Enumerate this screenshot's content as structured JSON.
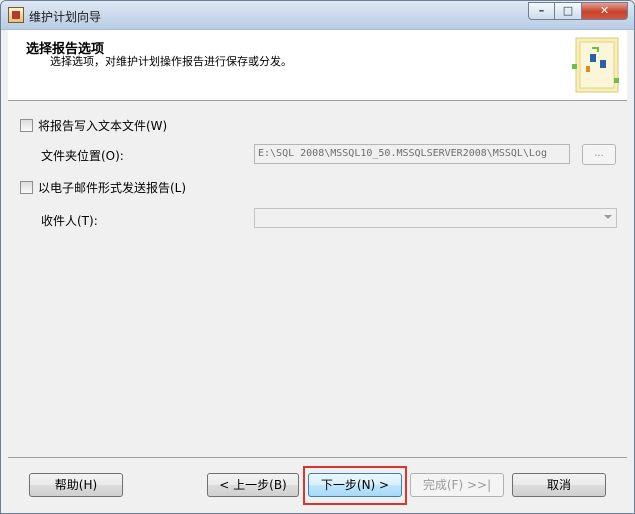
{
  "window": {
    "title": "维护计划向导",
    "minimize_glyph": "–",
    "maximize_glyph": "□",
    "close_glyph": "✕"
  },
  "header": {
    "title": "选择报告选项",
    "subtitle": "选择选项，对维护计划操作报告进行保存或分发。"
  },
  "options": {
    "write_to_file": {
      "label": "将报告写入文本文件(W)",
      "checked": false
    },
    "folder_location": {
      "label": "文件夹位置(O):",
      "value": "E:\\SQL 2008\\MSSQL10_50.MSSQLSERVER2008\\MSSQL\\Log"
    },
    "browse_label": "...",
    "email_report": {
      "label": "以电子邮件形式发送报告(L)",
      "checked": false
    },
    "recipient": {
      "label": "收件人(T):",
      "value": ""
    }
  },
  "footer": {
    "help": "帮助(H)",
    "back": "< 上一步(B)",
    "next": "下一步(N) >",
    "finish": "完成(F) >>|",
    "cancel": "取消"
  },
  "colors": {
    "highlight": "#d9362d",
    "header_bg": "#ffffff",
    "dialog_bg": "#f0f0f0"
  }
}
